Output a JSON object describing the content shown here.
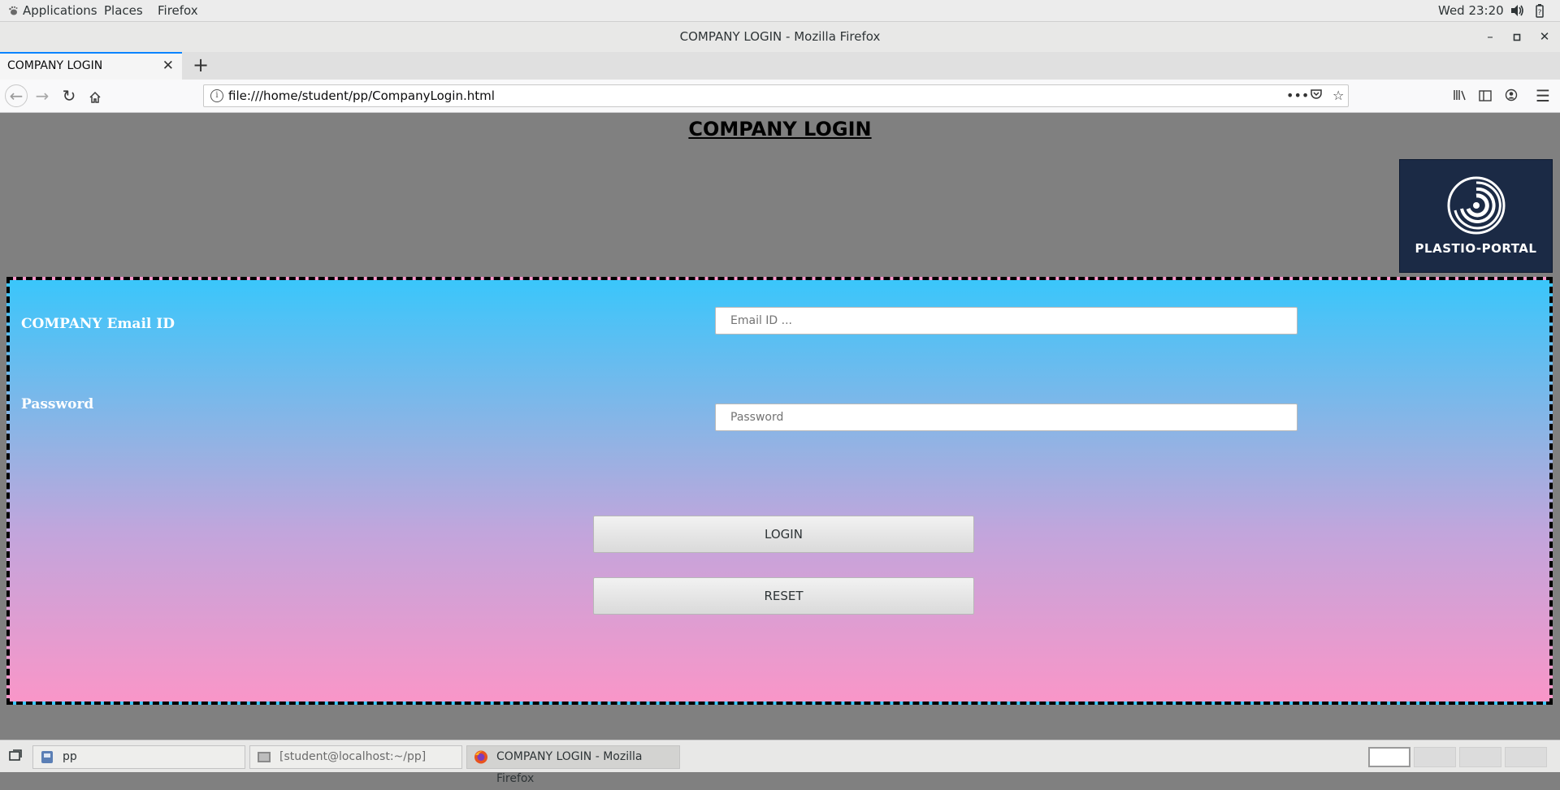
{
  "topbar": {
    "applications": "Applications",
    "places": "Places",
    "firefox": "Firefox",
    "clock": "Wed 23:20",
    "icons": [
      "speaker-icon",
      "battery-icon"
    ]
  },
  "window": {
    "title": "COMPANY LOGIN - Mozilla Firefox"
  },
  "tabs": [
    {
      "label": "COMPANY LOGIN"
    }
  ],
  "navbar": {
    "url": "file:///home/student/pp/CompanyLogin.html"
  },
  "page": {
    "heading": "COMPANY LOGIN",
    "logo_text": "PLASTIO-PORTAL",
    "email_label": "COMPANY Email ID",
    "email_placeholder": "Email ID ...",
    "password_label": "Password",
    "password_placeholder": "Password",
    "login_label": "LOGIN",
    "reset_label": "RESET",
    "colors": {
      "gradient_top": "#3ac6fb",
      "gradient_bottom": "#f996c8",
      "logo_bg": "#1b2a45"
    }
  },
  "taskbar": {
    "items": [
      {
        "label": "pp"
      },
      {
        "label": "[student@localhost:~/pp]"
      },
      {
        "label": "COMPANY LOGIN - Mozilla Firefox"
      }
    ]
  }
}
